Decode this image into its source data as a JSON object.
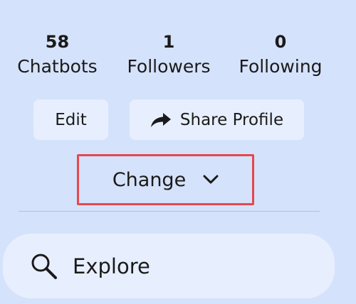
{
  "stats": [
    {
      "value": "58",
      "label": "Chatbots"
    },
    {
      "value": "1",
      "label": "Followers"
    },
    {
      "value": "0",
      "label": "Following"
    }
  ],
  "buttons": {
    "edit_label": "Edit",
    "share_label": "Share Profile",
    "share_icon": "share-arrow-icon"
  },
  "dropdown": {
    "label": "Change",
    "icon": "chevron-down-icon",
    "highlight_color": "#e5484d"
  },
  "nav": {
    "explore_label": "Explore",
    "explore_icon": "search-icon"
  },
  "colors": {
    "background": "#d5e2fb",
    "button_bg": "#e7efff",
    "divider": "#a9c3ec"
  }
}
